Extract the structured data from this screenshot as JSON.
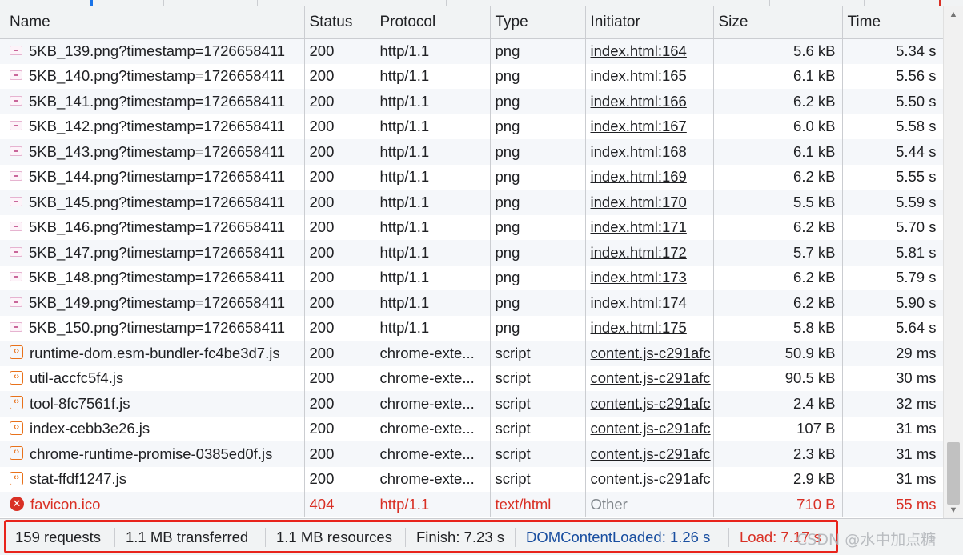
{
  "columns": {
    "name": "Name",
    "status": "Status",
    "protocol": "Protocol",
    "type": "Type",
    "initiator": "Initiator",
    "size": "Size",
    "time": "Time"
  },
  "rows": [
    {
      "icon": "image-icon",
      "name": "5KB_139.png?timestamp=1726658411",
      "status": "200",
      "protocol": "http/1.1",
      "type": "png",
      "initiator": "index.html:164",
      "size": "5.6 kB",
      "time": "5.34 s"
    },
    {
      "icon": "image-icon",
      "name": "5KB_140.png?timestamp=1726658411",
      "status": "200",
      "protocol": "http/1.1",
      "type": "png",
      "initiator": "index.html:165",
      "size": "6.1 kB",
      "time": "5.56 s"
    },
    {
      "icon": "image-icon",
      "name": "5KB_141.png?timestamp=1726658411",
      "status": "200",
      "protocol": "http/1.1",
      "type": "png",
      "initiator": "index.html:166",
      "size": "6.2 kB",
      "time": "5.50 s"
    },
    {
      "icon": "image-icon",
      "name": "5KB_142.png?timestamp=1726658411",
      "status": "200",
      "protocol": "http/1.1",
      "type": "png",
      "initiator": "index.html:167",
      "size": "6.0 kB",
      "time": "5.58 s"
    },
    {
      "icon": "image-icon",
      "name": "5KB_143.png?timestamp=1726658411",
      "status": "200",
      "protocol": "http/1.1",
      "type": "png",
      "initiator": "index.html:168",
      "size": "6.1 kB",
      "time": "5.44 s"
    },
    {
      "icon": "image-icon",
      "name": "5KB_144.png?timestamp=1726658411",
      "status": "200",
      "protocol": "http/1.1",
      "type": "png",
      "initiator": "index.html:169",
      "size": "6.2 kB",
      "time": "5.55 s"
    },
    {
      "icon": "image-icon",
      "name": "5KB_145.png?timestamp=1726658411",
      "status": "200",
      "protocol": "http/1.1",
      "type": "png",
      "initiator": "index.html:170",
      "size": "5.5 kB",
      "time": "5.59 s"
    },
    {
      "icon": "image-icon",
      "name": "5KB_146.png?timestamp=1726658411",
      "status": "200",
      "protocol": "http/1.1",
      "type": "png",
      "initiator": "index.html:171",
      "size": "6.2 kB",
      "time": "5.70 s"
    },
    {
      "icon": "image-icon",
      "name": "5KB_147.png?timestamp=1726658411",
      "status": "200",
      "protocol": "http/1.1",
      "type": "png",
      "initiator": "index.html:172",
      "size": "5.7 kB",
      "time": "5.81 s"
    },
    {
      "icon": "image-icon",
      "name": "5KB_148.png?timestamp=1726658411",
      "status": "200",
      "protocol": "http/1.1",
      "type": "png",
      "initiator": "index.html:173",
      "size": "6.2 kB",
      "time": "5.79 s"
    },
    {
      "icon": "image-icon",
      "name": "5KB_149.png?timestamp=1726658411",
      "status": "200",
      "protocol": "http/1.1",
      "type": "png",
      "initiator": "index.html:174",
      "size": "6.2 kB",
      "time": "5.90 s"
    },
    {
      "icon": "image-icon",
      "name": "5KB_150.png?timestamp=1726658411",
      "status": "200",
      "protocol": "http/1.1",
      "type": "png",
      "initiator": "index.html:175",
      "size": "5.8 kB",
      "time": "5.64 s"
    },
    {
      "icon": "script-icon",
      "name": "runtime-dom.esm-bundler-fc4be3d7.js",
      "status": "200",
      "protocol": "chrome-exte...",
      "type": "script",
      "initiator": "content.js-c291afc",
      "size": "50.9 kB",
      "time": "29 ms"
    },
    {
      "icon": "script-icon",
      "name": "util-accfc5f4.js",
      "status": "200",
      "protocol": "chrome-exte...",
      "type": "script",
      "initiator": "content.js-c291afc",
      "size": "90.5 kB",
      "time": "30 ms"
    },
    {
      "icon": "script-icon",
      "name": "tool-8fc7561f.js",
      "status": "200",
      "protocol": "chrome-exte...",
      "type": "script",
      "initiator": "content.js-c291afc",
      "size": "2.4 kB",
      "time": "32 ms"
    },
    {
      "icon": "script-icon",
      "name": "index-cebb3e26.js",
      "status": "200",
      "protocol": "chrome-exte...",
      "type": "script",
      "initiator": "content.js-c291afc",
      "size": "107 B",
      "time": "31 ms"
    },
    {
      "icon": "script-icon",
      "name": "chrome-runtime-promise-0385ed0f.js",
      "status": "200",
      "protocol": "chrome-exte...",
      "type": "script",
      "initiator": "content.js-c291afc",
      "size": "2.3 kB",
      "time": "31 ms"
    },
    {
      "icon": "script-icon",
      "name": "stat-ffdf1247.js",
      "status": "200",
      "protocol": "chrome-exte...",
      "type": "script",
      "initiator": "content.js-c291afc",
      "size": "2.9 kB",
      "time": "31 ms"
    },
    {
      "icon": "error-icon",
      "name": "favicon.ico",
      "status": "404",
      "protocol": "http/1.1",
      "type": "text/html",
      "initiator": "Other",
      "size": "710 B",
      "time": "55 ms",
      "error": true
    }
  ],
  "status_bar": {
    "requests": "159 requests",
    "transferred": "1.1 MB transferred",
    "resources": "1.1 MB resources",
    "finish": "Finish: 7.23 s",
    "dom_content_loaded": "DOMContentLoaded: 1.26 s",
    "load": "Load: 7.17 s"
  },
  "watermark": "CSDN @水中加点糖",
  "colors": {
    "error": "#d93025",
    "dom_content_loaded": "#1a4fa0",
    "highlight_box": "#e8231b"
  }
}
